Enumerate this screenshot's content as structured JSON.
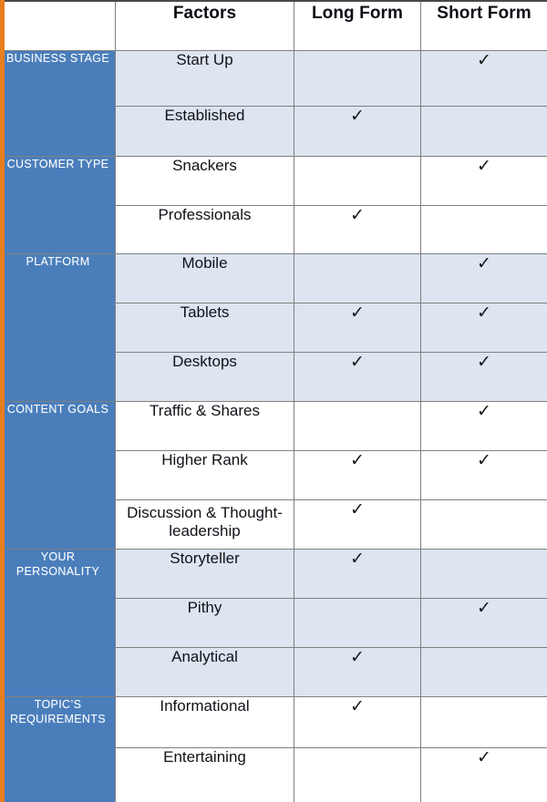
{
  "header": {
    "blank_label": "",
    "factors_label": "Factors",
    "long_form_label": "Long Form",
    "short_form_label": "Short Form"
  },
  "icons": {
    "check": "✓"
  },
  "colors": {
    "category_blue": "#4a7ebb",
    "band_light_blue": "#dce5f0",
    "band_white": "#ffffff",
    "accent_orange": "#e87d1e",
    "grid_line": "#808080",
    "top_rule": "#4a4a4a",
    "header_text": "#0d0d16",
    "category_text": "#ffffff"
  },
  "table": {
    "columns": [
      "",
      "Factors",
      "Long Form",
      "Short Form"
    ],
    "sections": [
      {
        "category": "BUSINESS STAGE",
        "band": "light",
        "rows": [
          {
            "factor": "Start Up",
            "long_form": false,
            "short_form": true
          },
          {
            "factor": "Established",
            "long_form": true,
            "short_form": false
          }
        ]
      },
      {
        "category": "CUSTOMER TYPE",
        "band": "white",
        "rows": [
          {
            "factor": "Snackers",
            "long_form": false,
            "short_form": true
          },
          {
            "factor": "Professionals",
            "long_form": true,
            "short_form": false
          }
        ]
      },
      {
        "category": "PLATFORM",
        "band": "light",
        "rows": [
          {
            "factor": "Mobile",
            "long_form": false,
            "short_form": true
          },
          {
            "factor": "Tablets",
            "long_form": true,
            "short_form": true
          },
          {
            "factor": "Desktops",
            "long_form": true,
            "short_form": true
          }
        ]
      },
      {
        "category": "CONTENT GOALS",
        "band": "white",
        "rows": [
          {
            "factor": "Traffic & Shares",
            "long_form": false,
            "short_form": true
          },
          {
            "factor": "Higher Rank",
            "long_form": true,
            "short_form": true
          },
          {
            "factor": "Discussion & Thought-leadership",
            "long_form": true,
            "short_form": false
          }
        ]
      },
      {
        "category": "YOUR PERSONALITY",
        "band": "light",
        "rows": [
          {
            "factor": "Storyteller",
            "long_form": true,
            "short_form": false
          },
          {
            "factor": "Pithy",
            "long_form": false,
            "short_form": true
          },
          {
            "factor": "Analytical",
            "long_form": true,
            "short_form": false
          }
        ]
      },
      {
        "category": "TOPIC’S REQUIREMENTS",
        "band": "white",
        "rows": [
          {
            "factor": "Informational",
            "long_form": true,
            "short_form": false
          },
          {
            "factor": "Entertaining",
            "long_form": false,
            "short_form": true
          }
        ]
      }
    ]
  }
}
